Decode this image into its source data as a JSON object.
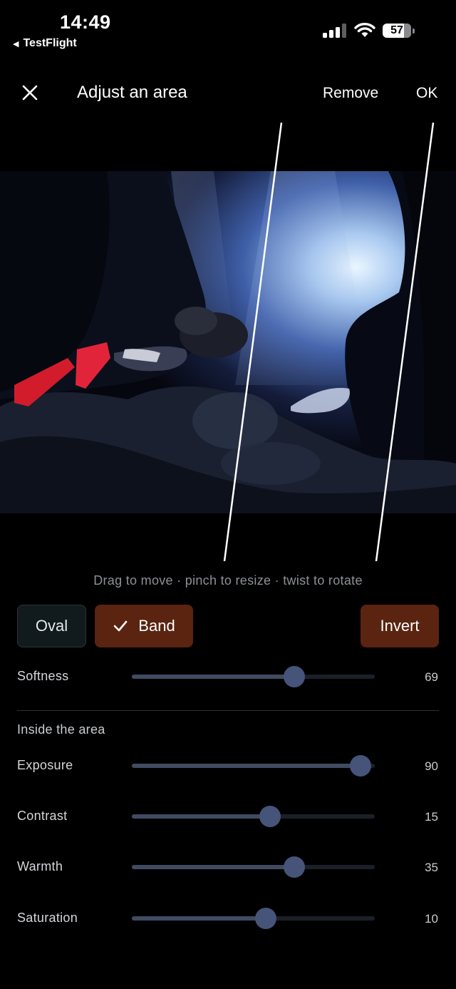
{
  "status_bar": {
    "time": "14:49",
    "back_app": "TestFlight",
    "battery": "57"
  },
  "header": {
    "title": "Adjust an area",
    "remove_label": "Remove",
    "ok_label": "OK"
  },
  "hint": "Drag to move · pinch to resize · twist to rotate",
  "shape_buttons": {
    "oval": "Oval",
    "band": "Band",
    "invert": "Invert",
    "selected": "Band"
  },
  "softness": {
    "label": "Softness",
    "value": "69",
    "fraction": 0.67
  },
  "section_title": "Inside the area",
  "adjustments": [
    {
      "label": "Exposure",
      "value": "90",
      "fraction": 0.94
    },
    {
      "label": "Contrast",
      "value": "15",
      "fraction": 0.57
    },
    {
      "label": "Warmth",
      "value": "35",
      "fraction": 0.67
    },
    {
      "label": "Saturation",
      "value": "10",
      "fraction": 0.55
    }
  ],
  "colors": {
    "accent": "#5a2410",
    "slider_thumb": "#46547a",
    "slider_fill": "#404b62"
  }
}
